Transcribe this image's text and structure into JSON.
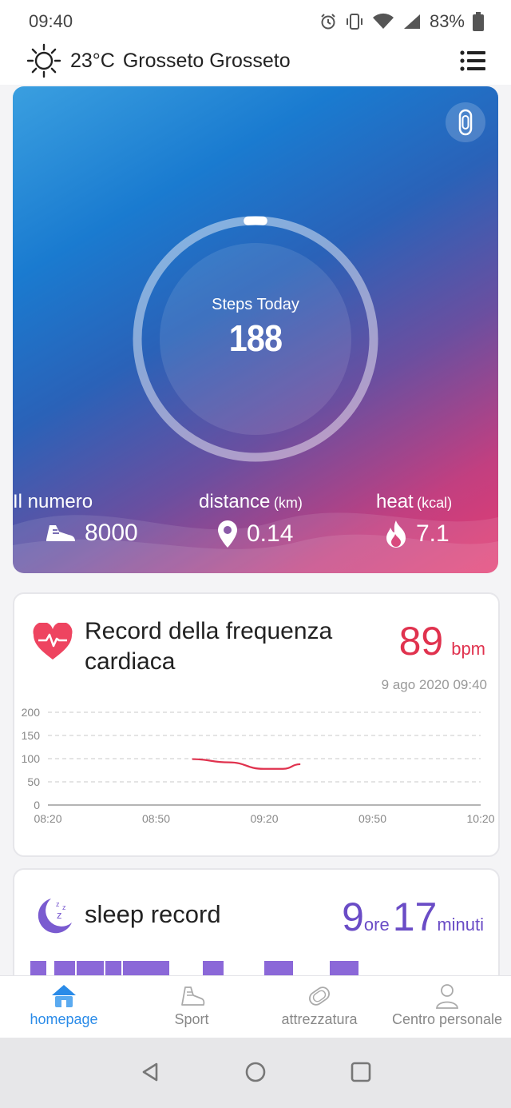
{
  "status_bar": {
    "time": "09:40",
    "battery": "83%"
  },
  "header": {
    "temperature": "23°C",
    "location": "Grosseto Grosseto"
  },
  "hero": {
    "steps_label": "Steps Today",
    "steps_value": "188",
    "goal_progress": 0.02,
    "stats": [
      {
        "label": "Il numero",
        "unit": "",
        "value": "8000",
        "icon": "shoe-icon"
      },
      {
        "label": "distance",
        "unit": "(km)",
        "value": "0.14",
        "icon": "location-pin-icon"
      },
      {
        "label": "heat",
        "unit": "(kcal)",
        "value": "7.1",
        "icon": "flame-icon"
      }
    ]
  },
  "heart_rate": {
    "title": "Record della frequenza cardiaca",
    "value": "89",
    "unit": "bpm",
    "datetime": "9 ago 2020 09:40",
    "accent": "#e0324e",
    "chart_data": {
      "type": "line",
      "ylim": [
        0,
        200
      ],
      "yticks": [
        "200",
        "150",
        "100",
        "50",
        "0"
      ],
      "xticks": [
        "08:20",
        "08:50",
        "09:20",
        "09:50",
        "10:20"
      ],
      "series": [
        {
          "values": [
            [
              9.0,
              99
            ],
            [
              9.17,
              92
            ],
            [
              9.33,
              78
            ],
            [
              9.42,
              78
            ],
            [
              9.5,
              88
            ]
          ]
        }
      ]
    }
  },
  "sleep": {
    "title": "sleep record",
    "hours": "9",
    "hours_unit": "ore",
    "minutes": "17",
    "minutes_unit": "minuti",
    "accent": "#6a4cc6"
  },
  "tabs": [
    {
      "label": "homepage",
      "icon": "home-icon",
      "active": true
    },
    {
      "label": "Sport",
      "icon": "running-shoe-icon",
      "active": false
    },
    {
      "label": "attrezzatura",
      "icon": "band-device-icon",
      "active": false
    },
    {
      "label": "Centro personale",
      "icon": "person-icon",
      "active": false
    }
  ]
}
